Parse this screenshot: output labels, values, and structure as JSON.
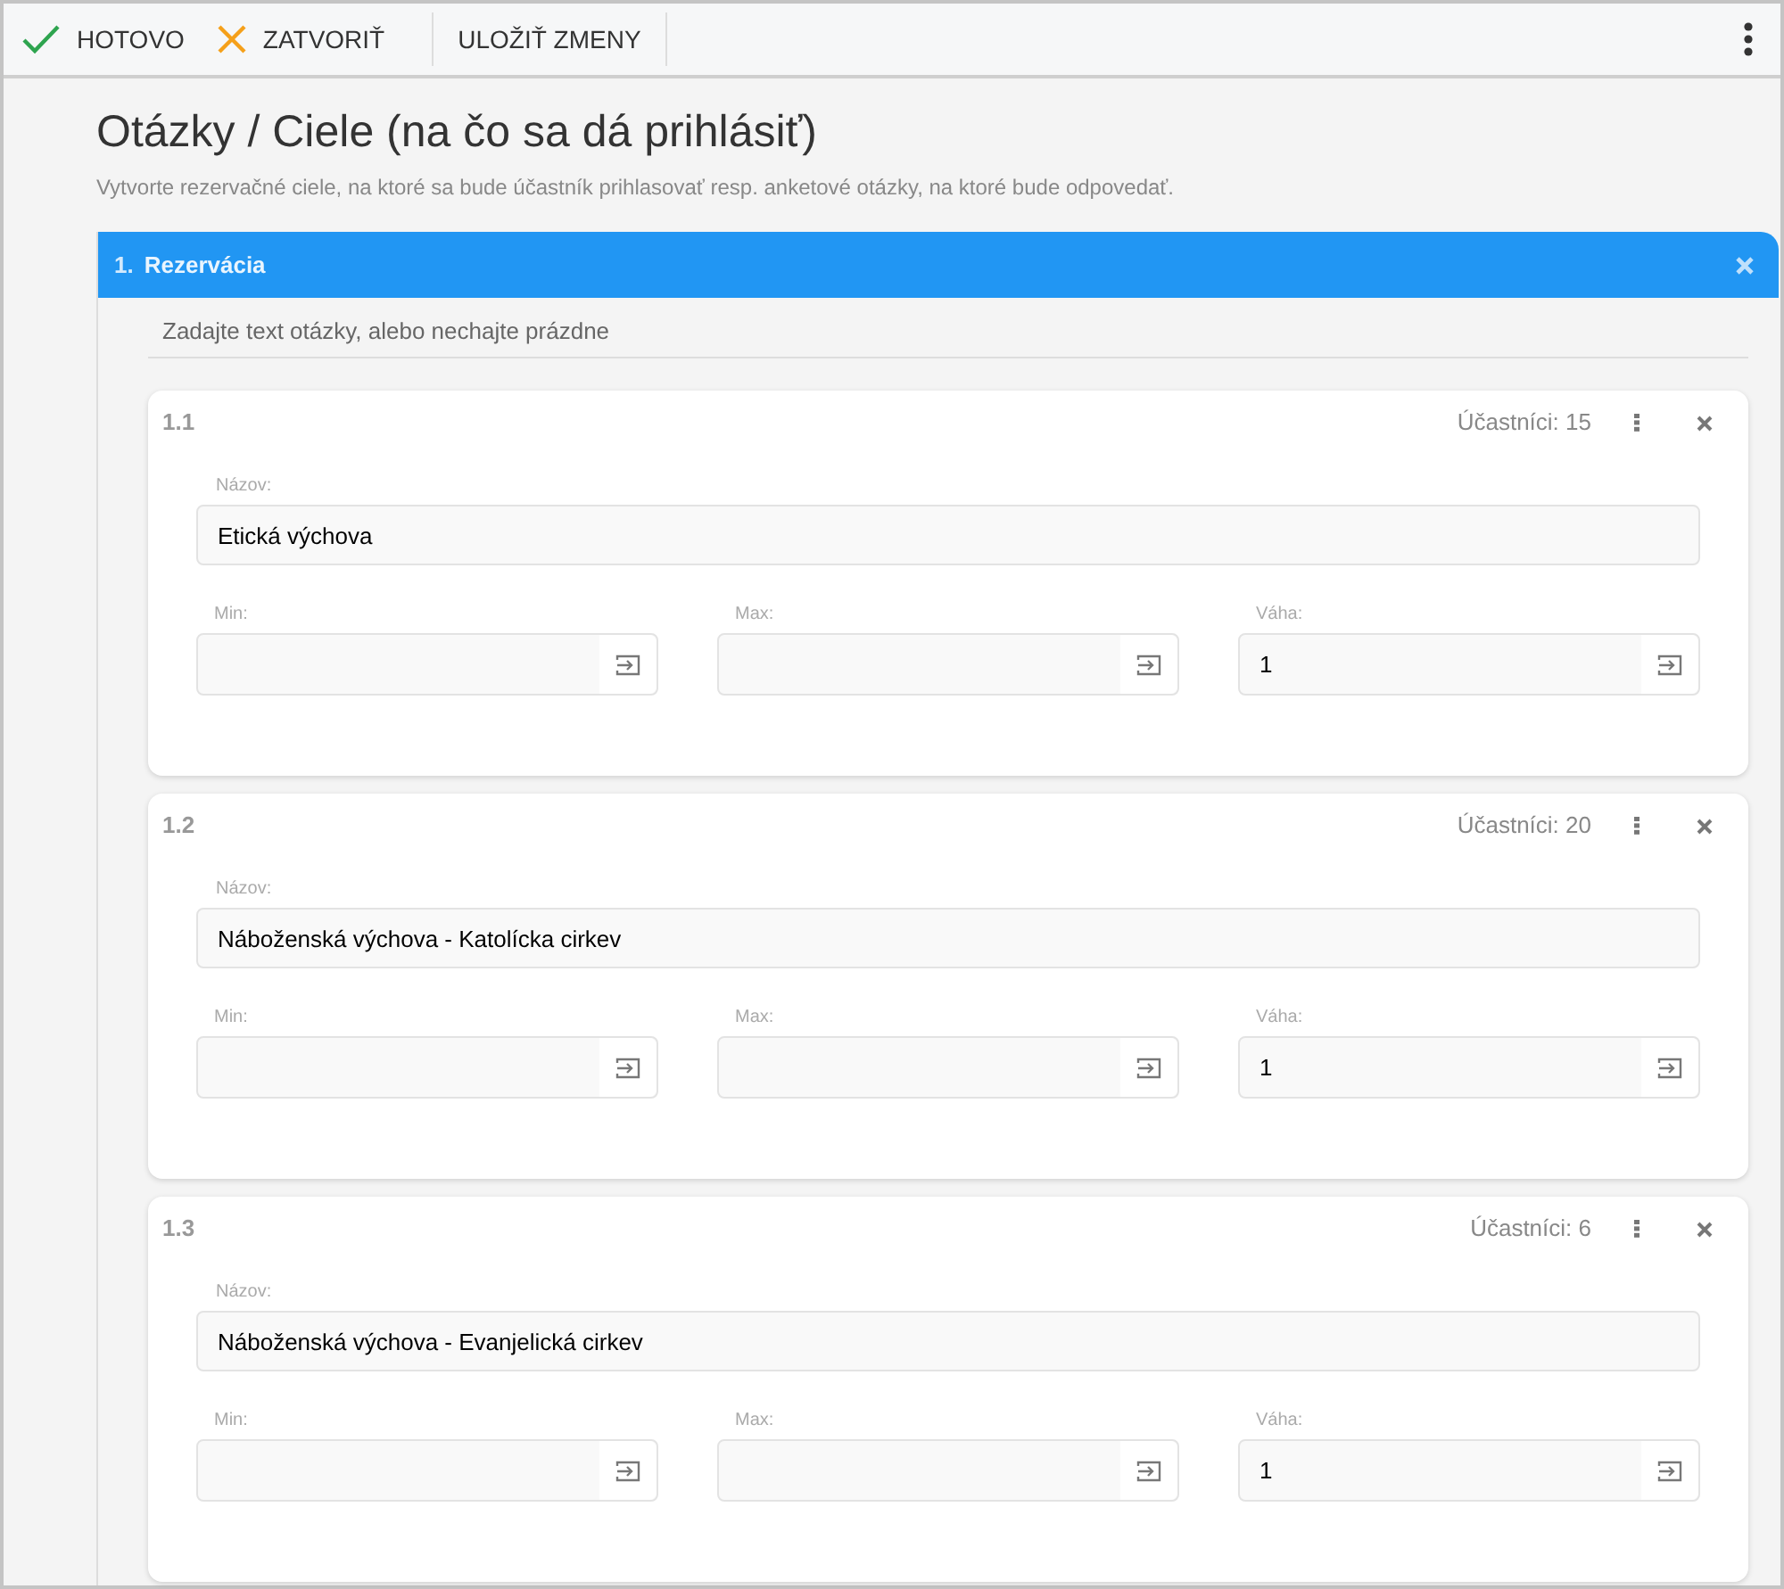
{
  "toolbar": {
    "buttons": [
      {
        "kind": "done",
        "label": "HOTOVO"
      },
      {
        "kind": "close",
        "label": "ZATVORIŤ"
      },
      {
        "kind": "plain",
        "label": "ULOŽIŤ ZMENY"
      }
    ]
  },
  "page": {
    "title": "Otázky / Ciele (na čo sa dá prihlásiť)",
    "subtitle": "Vytvorte rezervačné ciele, na ktoré sa bude účastník prihlasovať resp. anketové otázky, na ktoré bude odpovedať."
  },
  "section": {
    "number": "1.",
    "title": "Rezervácia",
    "question_placeholder": "Zadajte text otázky, alebo nechajte prázdne",
    "items": [
      {
        "number": "1.1",
        "participants": "Účastníci: 15",
        "name_label": "Názov:",
        "name": "Etická výchova",
        "min_label": "Min:",
        "max_label": "Max:",
        "weight_label": "Váha:",
        "weight": "1"
      },
      {
        "number": "1.2",
        "participants": "Účastníci: 20",
        "name_label": "Názov:",
        "name": "Náboženská výchova - Katolícka cirkev",
        "min_label": "Min:",
        "max_label": "Max:",
        "weight_label": "Váha:",
        "weight": "1"
      },
      {
        "number": "1.3",
        "participants": "Účastníci: 6",
        "name_label": "Názov:",
        "name": "Náboženská výchova - Evanjelická cirkev",
        "min_label": "Min:",
        "max_label": "Max:",
        "weight_label": "Váha:",
        "weight": "1"
      }
    ]
  }
}
